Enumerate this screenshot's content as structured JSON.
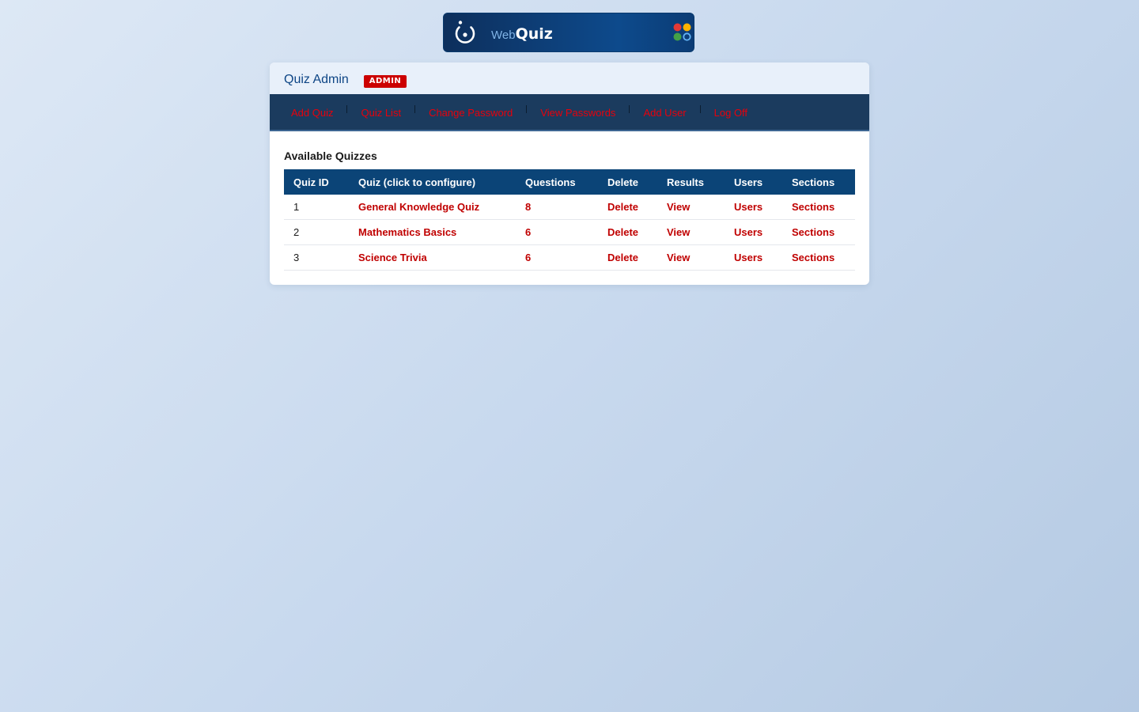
{
  "logo": {
    "prefix": "Web",
    "name": "Quiz",
    "dot_colors": [
      "#e53935",
      "#ffb300",
      "#43a047",
      "#64b5f6"
    ]
  },
  "header": {
    "title": "Quiz Admin",
    "badge": "ADMIN"
  },
  "nav": {
    "items": [
      {
        "label": "Add Quiz"
      },
      {
        "label": "Quiz List"
      },
      {
        "label": "Change Password"
      },
      {
        "label": "View Passwords"
      },
      {
        "label": "Add User"
      },
      {
        "label": "Log Off"
      }
    ]
  },
  "main": {
    "section_title": "Available Quizzes",
    "table": {
      "columns": [
        "Quiz ID",
        "Quiz (click to configure)",
        "Questions",
        "Delete",
        "Results",
        "Users",
        "Sections"
      ],
      "rows": [
        {
          "id": "1",
          "name": "General Knowledge Quiz",
          "questions": "8",
          "delete": "Delete",
          "results": "View",
          "users": "Users",
          "sections": "Sections"
        },
        {
          "id": "2",
          "name": "Mathematics Basics",
          "questions": "6",
          "delete": "Delete",
          "results": "View",
          "users": "Users",
          "sections": "Sections"
        },
        {
          "id": "3",
          "name": "Science Trivia",
          "questions": "6",
          "delete": "Delete",
          "results": "View",
          "users": "Users",
          "sections": "Sections"
        }
      ]
    }
  },
  "colors": {
    "nav_bg": "#1b3b5e",
    "nav_link": "#e8000b",
    "table_header": "#0b4477",
    "link": "#c00000",
    "title": "#0d4585",
    "badge": "#cc0000"
  }
}
